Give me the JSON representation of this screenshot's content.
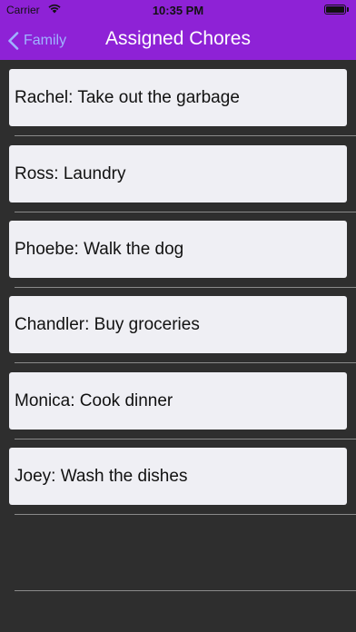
{
  "status_bar": {
    "carrier": "Carrier",
    "time": "10:35 PM",
    "wifi_icon": "wifi-icon",
    "battery_icon": "battery-icon",
    "battery_level": 1.0
  },
  "nav": {
    "back_label": "Family",
    "title": "Assigned Chores",
    "back_icon": "chevron-left-icon"
  },
  "chores": [
    {
      "label": "Rachel: Take out the garbage"
    },
    {
      "label": "Ross: Laundry"
    },
    {
      "label": "Phoebe: Walk the dog"
    },
    {
      "label": "Chandler: Buy groceries"
    },
    {
      "label": "Monica: Cook dinner"
    },
    {
      "label": "Joey: Wash the dishes"
    }
  ],
  "colors": {
    "nav_background": "#8e22d6",
    "back_tint": "#9fb3ff",
    "list_background": "#2e2e2e",
    "card_background": "#efeff4"
  }
}
